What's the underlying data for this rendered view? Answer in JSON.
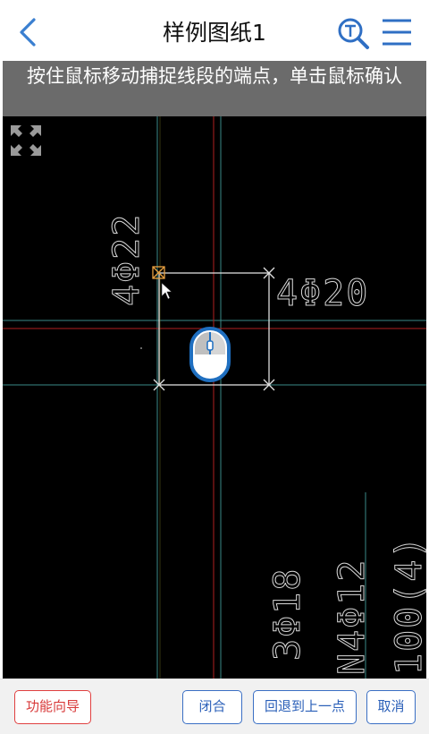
{
  "header": {
    "title": "样例图纸1"
  },
  "hint": {
    "text": "按住鼠标移动捕捉线段的端点，单击鼠标确认"
  },
  "drawing": {
    "labels": {
      "rebar_4_22": "4Φ22",
      "rebar_4_20": "4Φ20",
      "rebar_3_18": "3Φ18",
      "rebar_n4_12": "N4Φ12",
      "spacing": "100(4)"
    }
  },
  "toolbar": {
    "guide": "功能向导",
    "close": "闭合",
    "undo": "回退到上一点",
    "cancel": "取消"
  },
  "colors": {
    "accent": "#3a6fc4",
    "danger": "#e04040",
    "hint_bg": "#6b6b6b",
    "canvas_bg": "#000000"
  }
}
